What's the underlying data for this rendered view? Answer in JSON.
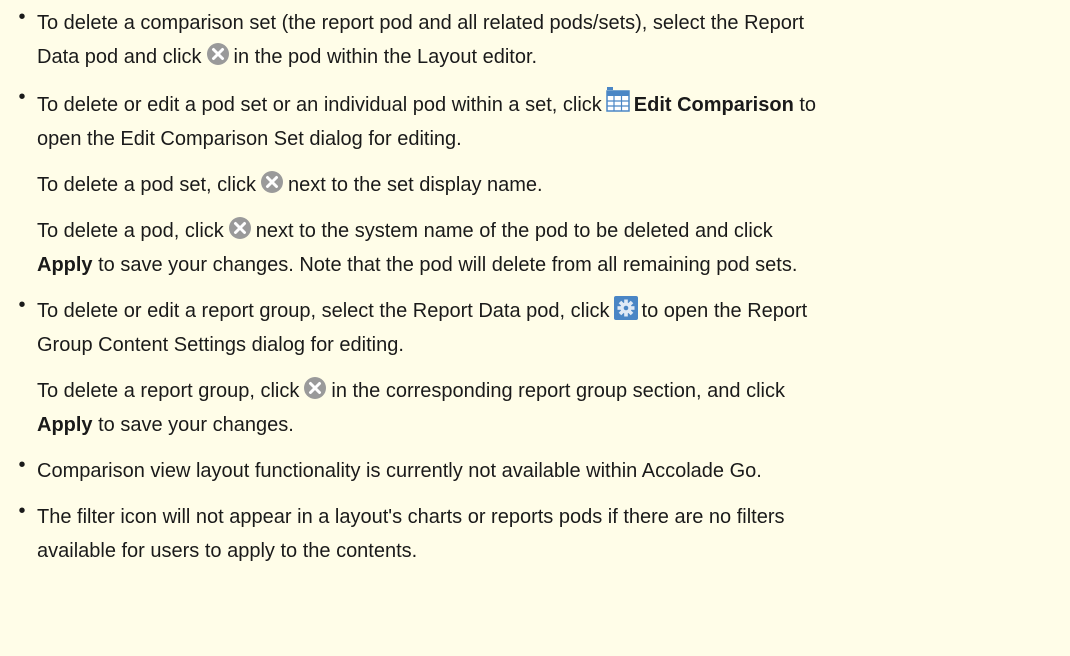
{
  "bullet_glyph": "•",
  "icons": {
    "delete": "close-circle-icon",
    "comparison": "table-grid-icon",
    "settings": "gear-icon"
  },
  "colors": {
    "background": "#FFFDE8",
    "text": "#1a1a1a",
    "icon_gray": "#9a9a9a",
    "icon_blue": "#4a86c5"
  },
  "items": [
    {
      "line1": "To delete a comparison set (the report pod and all related pods/sets), select the Report",
      "line2_pre": "Data pod and click",
      "line2_post": "in the pod within the Layout editor."
    },
    {
      "line1_pre": "To delete or edit a pod set or an individual pod within a set, click",
      "line1_bold": "Edit Comparison",
      "line1_post": "to",
      "line2": "open the Edit Comparison Set dialog for editing.",
      "sub1_pre": "To delete a pod set, click",
      "sub1_post": "next to the set display name.",
      "sub2_pre": "To delete a pod, click",
      "sub2_post": "next to the system name of the pod to be deleted and click",
      "sub2_line2_bold": "Apply",
      "sub2_line2_post": "to save your changes. Note that the pod will delete from all remaining pod sets."
    },
    {
      "line1_pre": "To delete or edit a report group, select the Report Data pod, click",
      "line1_post": "to open the Report",
      "line2": "Group Content Settings dialog for editing.",
      "sub1_pre": "To delete a report group, click",
      "sub1_post": "in the corresponding report group section, and click",
      "sub1_line2_bold": "Apply",
      "sub1_line2_post": "to save your changes."
    },
    {
      "line1": "Comparison view layout functionality is currently not available within Accolade Go."
    },
    {
      "line1": "The filter icon will not appear in a layout's charts or reports pods if there are no filters",
      "line2": "available for users to apply to the contents."
    }
  ]
}
